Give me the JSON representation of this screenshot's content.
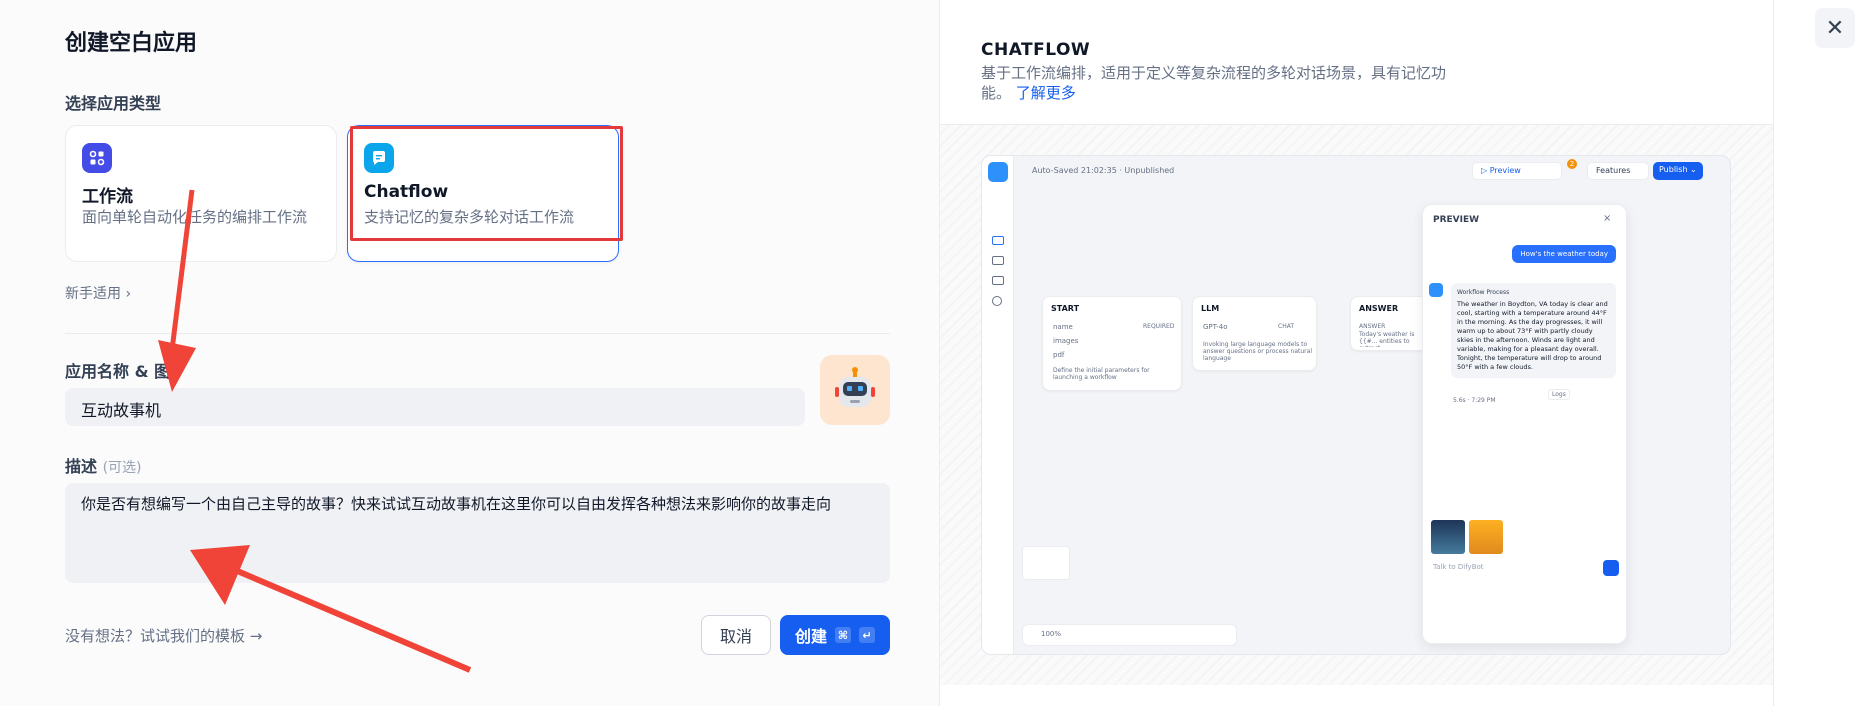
{
  "dialog": {
    "title": "创建空白应用",
    "type_label": "选择应用类型",
    "cards": [
      {
        "name": "工作流",
        "desc": "面向单轮自动化任务的编排工作流",
        "icon": "workflow-icon",
        "color": "#444ce7"
      },
      {
        "name": "Chatflow",
        "desc": "支持记忆的复杂多轮对话工作流",
        "icon": "chat-icon",
        "color": "#0ba5ec"
      }
    ],
    "beginner_link": "新手适用",
    "name_label": "应用名称 & 图",
    "name_value": "互动故事机",
    "desc_label": "描述",
    "desc_optional": "(可选)",
    "desc_value": "你是否有想编写一个由自己主导的故事？快来试试互动故事机在这里你可以自由发挥各种想法来影响你的故事走向",
    "template_link": "没有想法？试试我们的模板 →",
    "cancel": "取消",
    "create": "创建",
    "kbd_cmd": "⌘",
    "kbd_enter": "↵",
    "accent": "#155eef"
  },
  "preview": {
    "title": "CHATFLOW",
    "desc": "基于工作流编排，适用于定义等复杂流程的多轮对话场景，具有记忆功能。",
    "learn_more": "了解更多",
    "toolbar": {
      "autosaved": "Auto-Saved 21:02:35 · Unpublished",
      "preview": "▷ Preview",
      "features": "Features",
      "publish": "Publish ⌄",
      "badge": "2"
    },
    "nodes": {
      "start": {
        "title": "START",
        "vars": [
          "name",
          "images",
          "pdf"
        ],
        "tag": "REQUIRED",
        "note": "Define the initial parameters for launching a workflow"
      },
      "llm": {
        "title": "LLM",
        "model": "GPT-4o",
        "tag": "CHAT",
        "note": "Invoking large language models to answer questions or process natural language"
      },
      "answer": {
        "title": "ANSWER",
        "label": "ANSWER",
        "text": "Today's weather is {{#... entities to extract."
      }
    },
    "panel": {
      "title": "PREVIEW",
      "user_msg": "How's the weather today",
      "process": "Workflow Process",
      "bot_msg": "The weather in Boydton, VA today is clear and cool, starting with a temperature around 44°F in the morning. As the day progresses, it will warm up to about 73°F with partly cloudy skies in the afternoon. Winds are light and variable, making for a pleasant day overall. Tonight, the temperature will drop to around 50°F with a few clouds.",
      "meta": "5.6s · 7:29 PM",
      "logs": "Logs",
      "input_placeholder": "Talk to DifyBot"
    },
    "zoom": "100%"
  }
}
